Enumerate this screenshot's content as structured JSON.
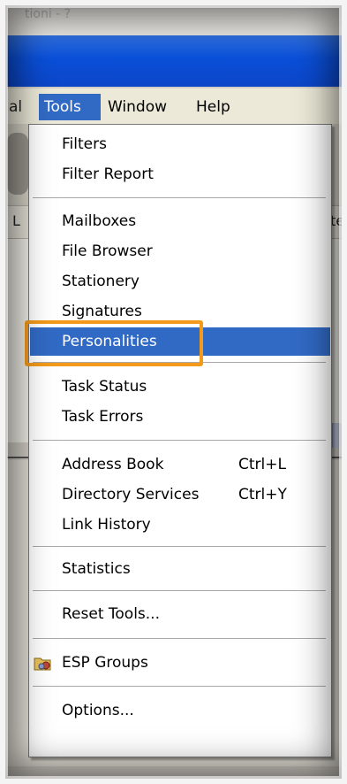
{
  "window": {
    "ghost_title": "tioni - ?"
  },
  "menubar": {
    "cut_label": "al",
    "items": [
      {
        "label": "Tools"
      },
      {
        "label": "Window"
      },
      {
        "label": "Help"
      }
    ]
  },
  "background": {
    "strip_left": "L",
    "strip_right": "te"
  },
  "tools_menu": {
    "items": [
      {
        "label": "Filters"
      },
      {
        "label": "Filter Report"
      },
      {
        "label": "Mailboxes"
      },
      {
        "label": "File Browser"
      },
      {
        "label": "Stationery"
      },
      {
        "label": "Signatures"
      },
      {
        "label": "Personalities"
      },
      {
        "label": "Task Status"
      },
      {
        "label": "Task Errors"
      },
      {
        "label": "Address Book",
        "shortcut": "Ctrl+L"
      },
      {
        "label": "Directory Services",
        "shortcut": "Ctrl+Y"
      },
      {
        "label": "Link History"
      },
      {
        "label": "Statistics"
      },
      {
        "label": "Reset Tools..."
      },
      {
        "label": "ESP Groups",
        "icon": "esp-groups-icon"
      },
      {
        "label": "Options..."
      }
    ],
    "highlighted": "Personalities"
  },
  "colors": {
    "highlight": "#316ac5",
    "titlebar": "#0a4fd8",
    "callout": "#f39a1a",
    "menu_bg": "#ece9d8"
  }
}
